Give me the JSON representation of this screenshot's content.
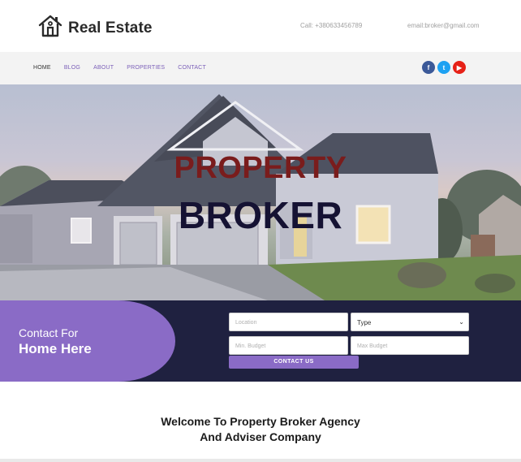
{
  "header": {
    "logo_text": "Real Estate",
    "call": "Call: +380633456789",
    "email": "email:broker@gmail.com"
  },
  "nav": {
    "items": [
      {
        "label": "HOME",
        "active": true
      },
      {
        "label": "BLOG"
      },
      {
        "label": "ABOUT"
      },
      {
        "label": "PROPERTIES"
      },
      {
        "label": "CONTACT"
      }
    ],
    "socials": [
      {
        "icon": "facebook-icon",
        "glyph": "f",
        "color": "#3b5998"
      },
      {
        "icon": "twitter-icon",
        "glyph": "t",
        "color": "#1da1f2"
      },
      {
        "icon": "youtube-icon",
        "glyph": "▶",
        "color": "#e62117"
      }
    ]
  },
  "hero": {
    "title_line1": "PROPERTY",
    "title_line2": "BROKER"
  },
  "contact": {
    "line1": "Contact For",
    "line2": "Home Here",
    "location_placeholder": "Location",
    "type_selected": "Type",
    "min_budget_placeholder": "Min. Budget",
    "max_budget_placeholder": "Max Budget",
    "submit_label": "CONTACT US"
  },
  "welcome": {
    "line1": "Welcome To Property Broker Agency",
    "line2": "And Adviser Company"
  },
  "colors": {
    "accent": "#8a6bc6",
    "dark": "#1f2140",
    "title_red": "#7a1c1c"
  }
}
